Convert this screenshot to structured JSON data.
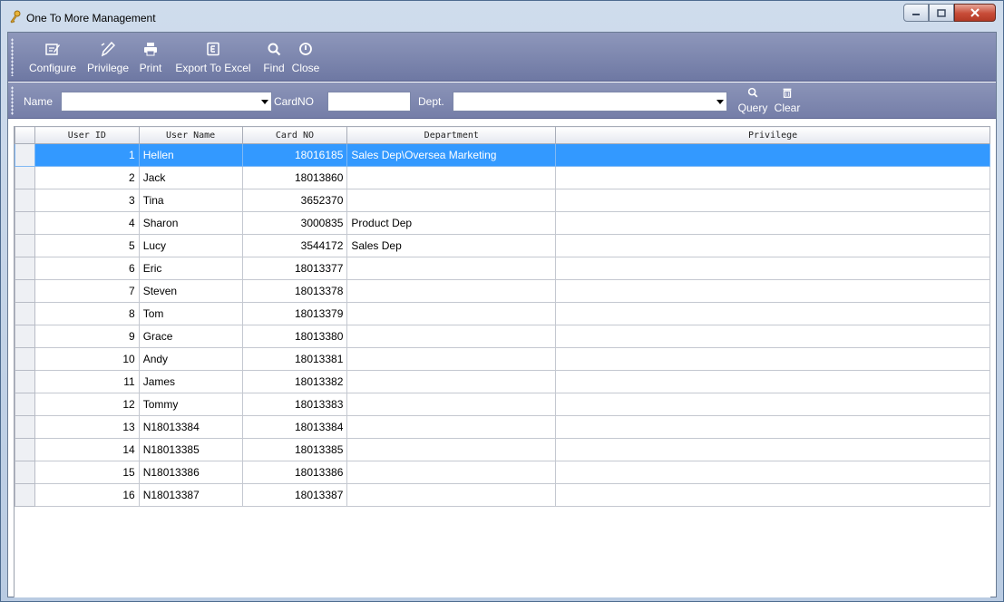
{
  "window": {
    "title": "One To More Management",
    "accent": "#3399ff"
  },
  "toolbar": {
    "items": [
      {
        "label": "Configure",
        "icon": "configure-icon"
      },
      {
        "label": "Privilege",
        "icon": "privilege-icon"
      },
      {
        "label": "Print",
        "icon": "printer-icon"
      },
      {
        "label": "Export To Excel",
        "icon": "excel-icon"
      },
      {
        "label": "Find",
        "icon": "search-icon"
      },
      {
        "label": "Close",
        "icon": "power-icon"
      }
    ]
  },
  "filters": {
    "name_label": "Name",
    "name_value": "",
    "card_label": "CardNO",
    "card_value": "",
    "dept_label": "Dept.",
    "dept_value": "",
    "query_label": "Query",
    "clear_label": "Clear"
  },
  "table": {
    "columns": [
      "User ID",
      "User Name",
      "Card NO",
      "Department",
      "Privilege"
    ],
    "selected_row": 0,
    "rows": [
      {
        "id": "1",
        "name": "Hellen",
        "card": "18016185",
        "dept": "Sales Dep\\Oversea Marketing",
        "priv": ""
      },
      {
        "id": "2",
        "name": "Jack",
        "card": "18013860",
        "dept": "",
        "priv": ""
      },
      {
        "id": "3",
        "name": "Tina",
        "card": "3652370",
        "dept": "",
        "priv": ""
      },
      {
        "id": "4",
        "name": "Sharon",
        "card": "3000835",
        "dept": "Product Dep",
        "priv": ""
      },
      {
        "id": "5",
        "name": "Lucy",
        "card": "3544172",
        "dept": "Sales Dep",
        "priv": ""
      },
      {
        "id": "6",
        "name": "Eric",
        "card": "18013377",
        "dept": "",
        "priv": ""
      },
      {
        "id": "7",
        "name": "Steven",
        "card": "18013378",
        "dept": "",
        "priv": ""
      },
      {
        "id": "8",
        "name": "Tom",
        "card": "18013379",
        "dept": "",
        "priv": ""
      },
      {
        "id": "9",
        "name": "Grace",
        "card": "18013380",
        "dept": "",
        "priv": ""
      },
      {
        "id": "10",
        "name": "Andy",
        "card": "18013381",
        "dept": "",
        "priv": ""
      },
      {
        "id": "11",
        "name": "James",
        "card": "18013382",
        "dept": "",
        "priv": ""
      },
      {
        "id": "12",
        "name": "Tommy",
        "card": "18013383",
        "dept": "",
        "priv": ""
      },
      {
        "id": "13",
        "name": "N18013384",
        "card": "18013384",
        "dept": "",
        "priv": ""
      },
      {
        "id": "14",
        "name": "N18013385",
        "card": "18013385",
        "dept": "",
        "priv": ""
      },
      {
        "id": "15",
        "name": "N18013386",
        "card": "18013386",
        "dept": "",
        "priv": ""
      },
      {
        "id": "16",
        "name": "N18013387",
        "card": "18013387",
        "dept": "",
        "priv": ""
      }
    ]
  }
}
